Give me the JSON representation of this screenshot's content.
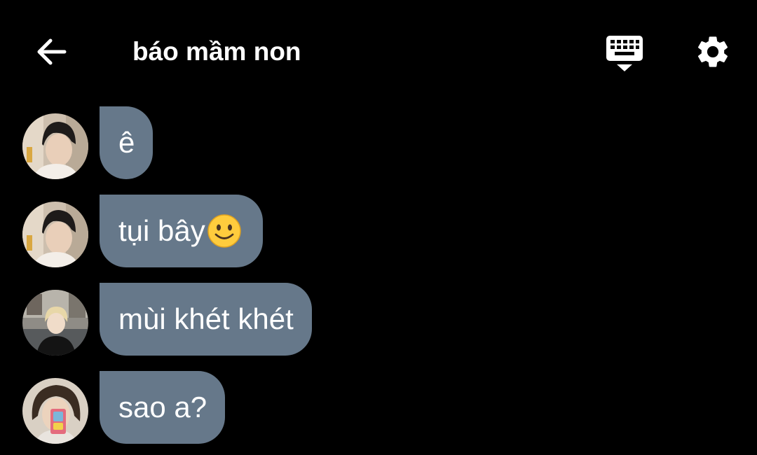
{
  "header": {
    "back_icon": "arrow-left-icon",
    "title": "báo mầm non",
    "keyboard_icon": "keyboard-hide-icon",
    "settings_icon": "gear-icon"
  },
  "messages": [
    {
      "text": "ê",
      "emoji": ""
    },
    {
      "text": "tụi bây",
      "emoji": "slightly-smiling-face"
    },
    {
      "text": "mùi khét khét",
      "emoji": ""
    },
    {
      "text": "sao a?",
      "emoji": ""
    }
  ],
  "colors": {
    "background": "#000000",
    "bubble": "#66788a",
    "text": "#ffffff"
  }
}
